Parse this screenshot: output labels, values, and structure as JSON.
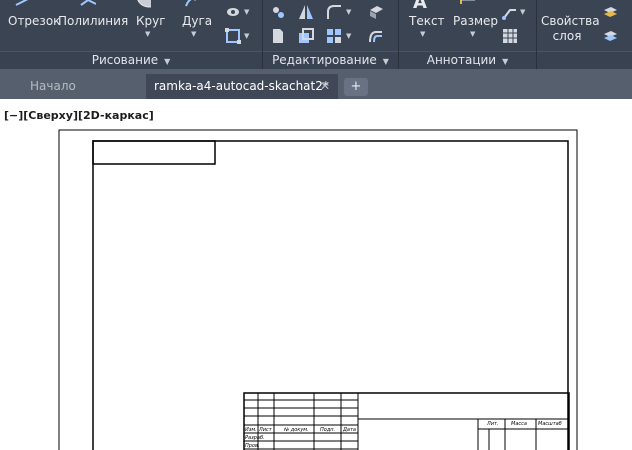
{
  "ribbon": {
    "draw_tools": {
      "line": "Отрезок",
      "polyline": "Полилиния",
      "circle": "Круг",
      "arc": "Дуга"
    },
    "panels": {
      "draw": "Рисование",
      "modify": "Редактирование",
      "annotation": "Аннотации"
    },
    "annotation_tools": {
      "text": "Текст",
      "dimension": "Размер"
    },
    "layers": {
      "properties_line1": "Свойства",
      "properties_line2": "слоя"
    }
  },
  "tabs": {
    "start": "Начало",
    "file": "ramka-a4-autocad-skachat2*",
    "add": "+"
  },
  "viewport": {
    "controls": "[−]",
    "view": "[Сверху]",
    "style": "[2D-каркас]"
  },
  "title_block": {
    "col_change": "Изм.",
    "col_sheet": "Лист",
    "col_doc": "№ докум.",
    "col_sign": "Подп.",
    "col_date": "Дата",
    "row_developer": "Разраб.",
    "row_checker": "Пров.",
    "col_lit": "Лит.",
    "col_mass": "Масса",
    "col_scale": "Масштаб"
  },
  "colors": {
    "ribbon_bg": "#3b4453",
    "tabbar_bg": "#565f6d",
    "active_tab_bg": "#404857",
    "canvas_bg": "#ffffff",
    "line_color": "#000000"
  }
}
